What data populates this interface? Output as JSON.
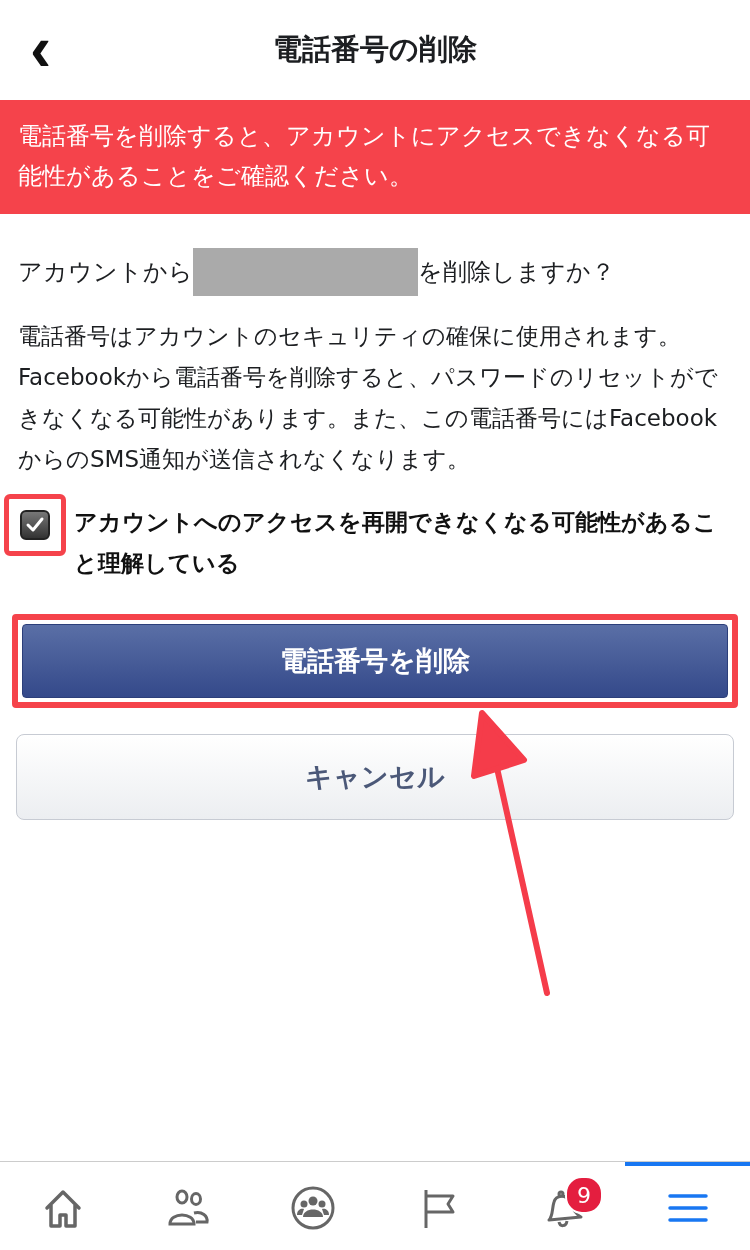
{
  "header": {
    "back": "‹",
    "title": "電話番号の削除"
  },
  "warning": "電話番号を削除すると、アカウントにアクセスできなくなる可能性があることをご確認ください。",
  "question": {
    "before": "アカウントから",
    "after": "を削除しますか？"
  },
  "description": "電話番号はアカウントのセキュリティの確保に使用されます。Facebookから電話番号を削除すると、パスワードのリセットができなくなる可能性があります。また、この電話番号にはFacebookからのSMS通知が送信されなくなります。",
  "confirm": {
    "label": "アカウントへのアクセスを再開できなくなる可能性があること理解している",
    "checked": true
  },
  "buttons": [
    {
      "kind": "primary",
      "label": "電話番号を削除"
    },
    {
      "kind": "secondary",
      "label": "キャンセル"
    }
  ],
  "tab_bar": [
    {
      "kind": "home",
      "selected": false
    },
    {
      "kind": "friends",
      "selected": false
    },
    {
      "kind": "groups",
      "selected": false
    },
    {
      "kind": "pages",
      "selected": false
    },
    {
      "kind": "notifications",
      "selected": false,
      "badge": "9"
    },
    {
      "kind": "menu",
      "selected": true
    }
  ]
}
